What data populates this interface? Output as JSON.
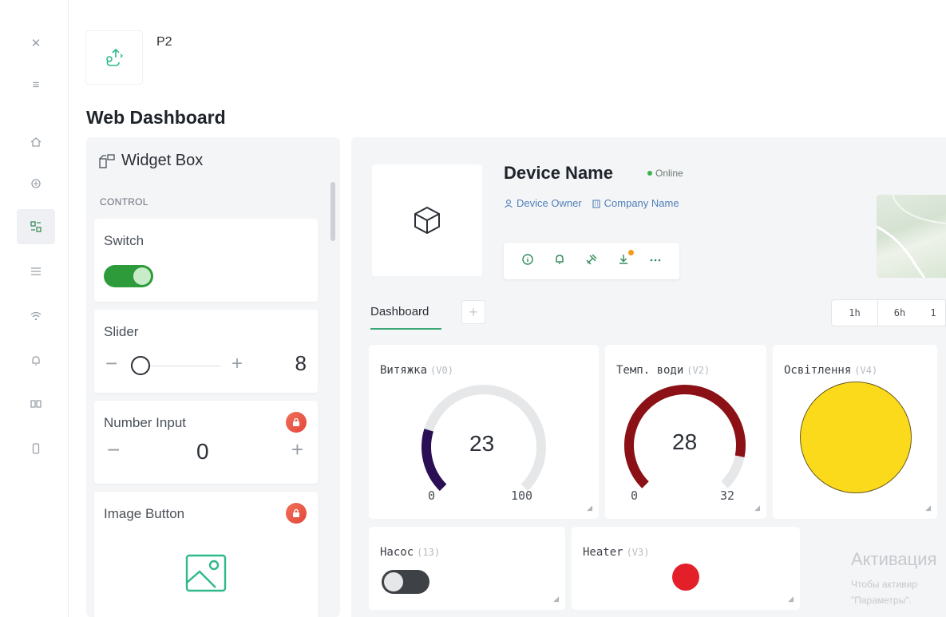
{
  "app": {
    "name": "P2"
  },
  "page": {
    "title": "Web Dashboard"
  },
  "rail": {
    "items": [
      {
        "name": "close-icon",
        "glyph": "✕"
      },
      {
        "name": "menu-icon",
        "glyph": "≡"
      },
      {
        "name": "home-icon",
        "glyph": "⌂"
      },
      {
        "name": "developer-icon",
        "glyph": "⚙"
      },
      {
        "name": "dashboard-icon",
        "glyph": "▦"
      },
      {
        "name": "list-icon",
        "glyph": "☰"
      },
      {
        "name": "wifi-icon",
        "glyph": "▾"
      },
      {
        "name": "bell-icon",
        "glyph": "♫"
      },
      {
        "name": "book-icon",
        "glyph": "▭"
      },
      {
        "name": "phone-icon",
        "glyph": "▯"
      }
    ]
  },
  "widget_box": {
    "title": "Widget Box",
    "section": "CONTROL",
    "widgets": {
      "switch": {
        "label": "Switch"
      },
      "slider": {
        "label": "Slider",
        "minus": "−",
        "plus": "+",
        "value": "8"
      },
      "number_input": {
        "label": "Number Input",
        "minus": "−",
        "value": "0",
        "plus": "+"
      },
      "image_button": {
        "label": "Image Button"
      }
    }
  },
  "device": {
    "name": "Device Name",
    "status": "Online",
    "owner": "Device Owner",
    "company": "Company Name"
  },
  "tabs": {
    "dashboard": "Dashboard",
    "add": "+"
  },
  "time_range": {
    "opt1": "1h",
    "opt2": "6h",
    "opt3": "1"
  },
  "tiles": {
    "vytyazhka": {
      "title": "Витяжка",
      "pin": "(V0)",
      "value": "23",
      "min": "0",
      "max": "100",
      "fraction": 0.23,
      "color": "#2a0f55"
    },
    "temp": {
      "title": "Темп. води",
      "pin": "(V2)",
      "value": "28",
      "min": "0",
      "max": "32",
      "fraction": 0.875,
      "color": "#8b1116"
    },
    "light": {
      "title": "Освітлення",
      "pin": "(V4)",
      "color": "#fbda1c"
    },
    "pump": {
      "title": "Насос",
      "pin": "(13)"
    },
    "heater": {
      "title": "Heater",
      "pin": "(V3)",
      "color": "#e3202a"
    }
  },
  "watermark": {
    "title": "Активация",
    "line1": "Чтобы активир",
    "line2": "\"Параметры\"."
  },
  "colors": {
    "accent": "#3aa876",
    "switch_on": "#2e9b3a",
    "status_online": "#37b24d"
  }
}
